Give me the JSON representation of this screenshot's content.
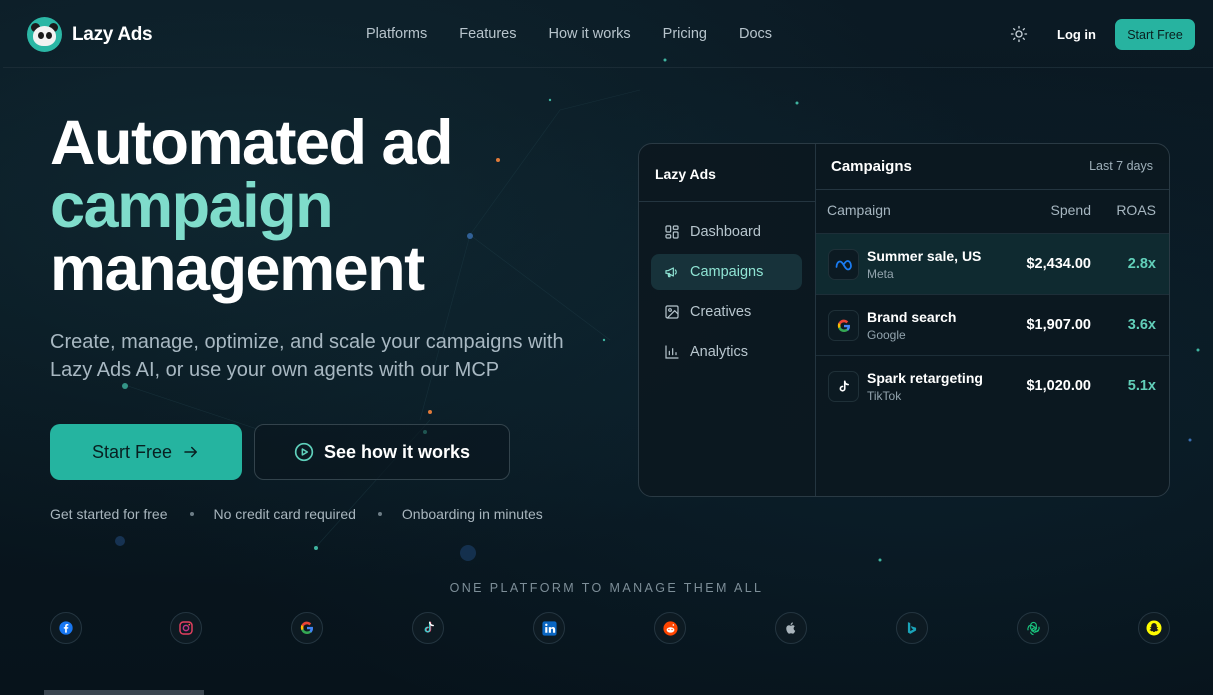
{
  "brand": {
    "name": "Lazy Ads"
  },
  "nav": {
    "items": [
      "Platforms",
      "Features",
      "How it works",
      "Pricing",
      "Docs"
    ],
    "login": "Log in",
    "start": "Start Free"
  },
  "hero": {
    "line1": "Automated ad",
    "line2": "campaign",
    "line3": "management",
    "subtitle": "Create, manage, optimize, and scale your campaigns with Lazy Ads AI, or use your own agents with our MCP",
    "primary_cta": "Start Free",
    "secondary_cta": "See how it works",
    "perks": [
      "Get started for free",
      "No credit card required",
      "Onboarding in minutes"
    ]
  },
  "panel": {
    "sidebar_title": "Lazy Ads",
    "sidebar_items": [
      {
        "label": "Dashboard",
        "icon": "grid-icon"
      },
      {
        "label": "Campaigns",
        "icon": "megaphone-icon",
        "active": true
      },
      {
        "label": "Creatives",
        "icon": "image-icon"
      },
      {
        "label": "Analytics",
        "icon": "bar-chart-icon"
      }
    ],
    "title": "Campaigns",
    "range": "Last 7 days",
    "columns": [
      "Campaign",
      "Spend",
      "ROAS"
    ],
    "rows": [
      {
        "name": "Summer sale, US",
        "platform": "Meta",
        "spend": "$2,434.00",
        "roas": "2.8x",
        "icon": "meta-icon"
      },
      {
        "name": "Brand search",
        "platform": "Google",
        "spend": "$1,907.00",
        "roas": "3.6x",
        "icon": "google-icon"
      },
      {
        "name": "Spark retargeting",
        "platform": "TikTok",
        "spend": "$1,020.00",
        "roas": "5.1x",
        "icon": "tiktok-icon"
      }
    ]
  },
  "platforms": {
    "title": "ONE PLATFORM TO MANAGE THEM ALL",
    "icons": [
      "facebook-icon",
      "instagram-icon",
      "google-icon",
      "tiktok-icon",
      "linkedin-icon",
      "reddit-icon",
      "apple-icon",
      "bing-icon",
      "openai-icon",
      "snapchat-icon"
    ]
  },
  "colors": {
    "accent": "#25b4a0",
    "accent_text": "#7fdccb",
    "background": "#0a1620"
  }
}
